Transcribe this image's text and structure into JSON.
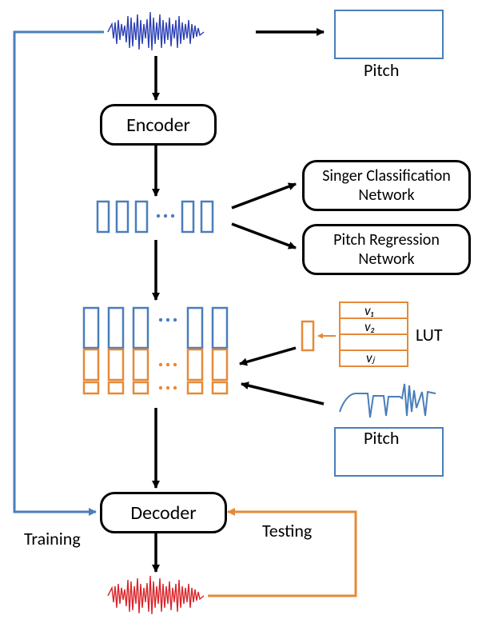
{
  "labels": {
    "encoder": "Encoder",
    "decoder": "Decoder",
    "singer_classification": "Singer Classification\nNetwork",
    "pitch_regression": "Pitch Regression\nNetwork",
    "pitch1": "Pitch",
    "pitch2": "Pitch",
    "training": "Training",
    "testing": "Testing",
    "lut": "LUT",
    "v1": "v₁",
    "v2": "v₂",
    "vj": "vⱼ"
  },
  "colors": {
    "blue": "#4a7ebb",
    "orange": "#e58a3a",
    "red": "#d9252a",
    "black": "#000000"
  },
  "chart_data": {
    "type": "diagram",
    "nodes": [
      {
        "id": "input-waveform",
        "label": "Input audio waveform",
        "color": "blue"
      },
      {
        "id": "pitch-top",
        "label": "Pitch",
        "type": "pitch-plot"
      },
      {
        "id": "encoder",
        "label": "Encoder"
      },
      {
        "id": "latent-tokens",
        "label": "Encoder output token sequence",
        "color": "blue"
      },
      {
        "id": "singer-cls",
        "label": "Singer Classification Network"
      },
      {
        "id": "pitch-reg",
        "label": "Pitch Regression Network"
      },
      {
        "id": "concat-tokens",
        "label": "Concatenated token sequence (latent + singer embedding + pitch)",
        "colors": [
          "blue",
          "orange",
          "orange"
        ]
      },
      {
        "id": "lut",
        "label": "LUT",
        "entries": [
          "v1",
          "v2",
          "vj"
        ],
        "color": "orange"
      },
      {
        "id": "pitch-bottom",
        "label": "Pitch",
        "type": "pitch-plot"
      },
      {
        "id": "decoder",
        "label": "Decoder"
      },
      {
        "id": "output-waveform",
        "label": "Output audio waveform",
        "color": "red"
      }
    ],
    "edges": [
      {
        "from": "input-waveform",
        "to": "pitch-top",
        "color": "black"
      },
      {
        "from": "input-waveform",
        "to": "encoder",
        "color": "black"
      },
      {
        "from": "encoder",
        "to": "latent-tokens",
        "color": "black"
      },
      {
        "from": "latent-tokens",
        "to": "singer-cls",
        "color": "black"
      },
      {
        "from": "latent-tokens",
        "to": "pitch-reg",
        "color": "black"
      },
      {
        "from": "latent-tokens",
        "to": "concat-tokens",
        "color": "black"
      },
      {
        "from": "lut",
        "to": "concat-tokens",
        "color": "black"
      },
      {
        "from": "pitch-bottom",
        "to": "concat-tokens",
        "color": "black"
      },
      {
        "from": "concat-tokens",
        "to": "decoder",
        "color": "black"
      },
      {
        "from": "decoder",
        "to": "output-waveform",
        "color": "black"
      },
      {
        "from": "input-waveform",
        "to": "decoder",
        "label": "Training",
        "color": "blue"
      },
      {
        "from": "output-waveform",
        "to": "decoder",
        "label": "Testing",
        "color": "orange"
      }
    ]
  }
}
